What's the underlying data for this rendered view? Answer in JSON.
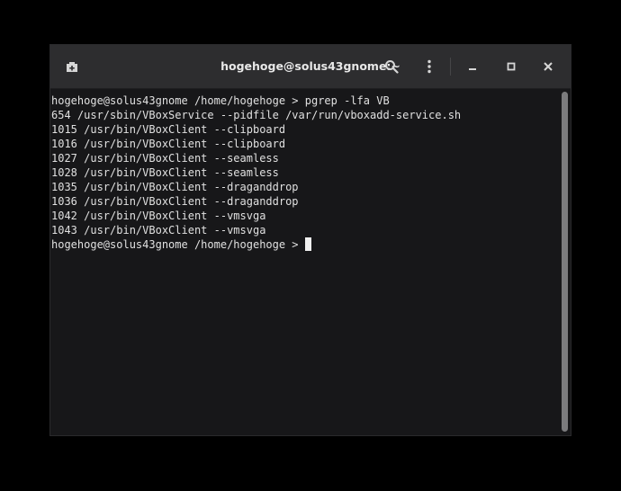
{
  "window": {
    "title": "hogehoge@solus43gnome:~"
  },
  "titlebar": {
    "new_tab_icon": "new-tab-icon",
    "search_icon": "search-icon",
    "menu_icon": "kebab-menu-icon",
    "minimize_icon": "minimize-icon",
    "maximize_icon": "maximize-icon",
    "close_icon": "close-icon"
  },
  "terminal": {
    "lines": [
      "hogehoge@solus43gnome /home/hogehoge > pgrep -lfa VB",
      "654 /usr/sbin/VBoxService --pidfile /var/run/vboxadd-service.sh",
      "1015 /usr/bin/VBoxClient --clipboard",
      "1016 /usr/bin/VBoxClient --clipboard",
      "1027 /usr/bin/VBoxClient --seamless",
      "1028 /usr/bin/VBoxClient --seamless",
      "1035 /usr/bin/VBoxClient --draganddrop",
      "1036 /usr/bin/VBoxClient --draganddrop",
      "1042 /usr/bin/VBoxClient --vmsvga",
      "1043 /usr/bin/VBoxClient --vmsvga"
    ],
    "prompt": "hogehoge@solus43gnome /home/hogehoge > "
  },
  "colors": {
    "background": "#171719",
    "titlebar": "#2d2d2f",
    "text": "#e0e0e0"
  }
}
